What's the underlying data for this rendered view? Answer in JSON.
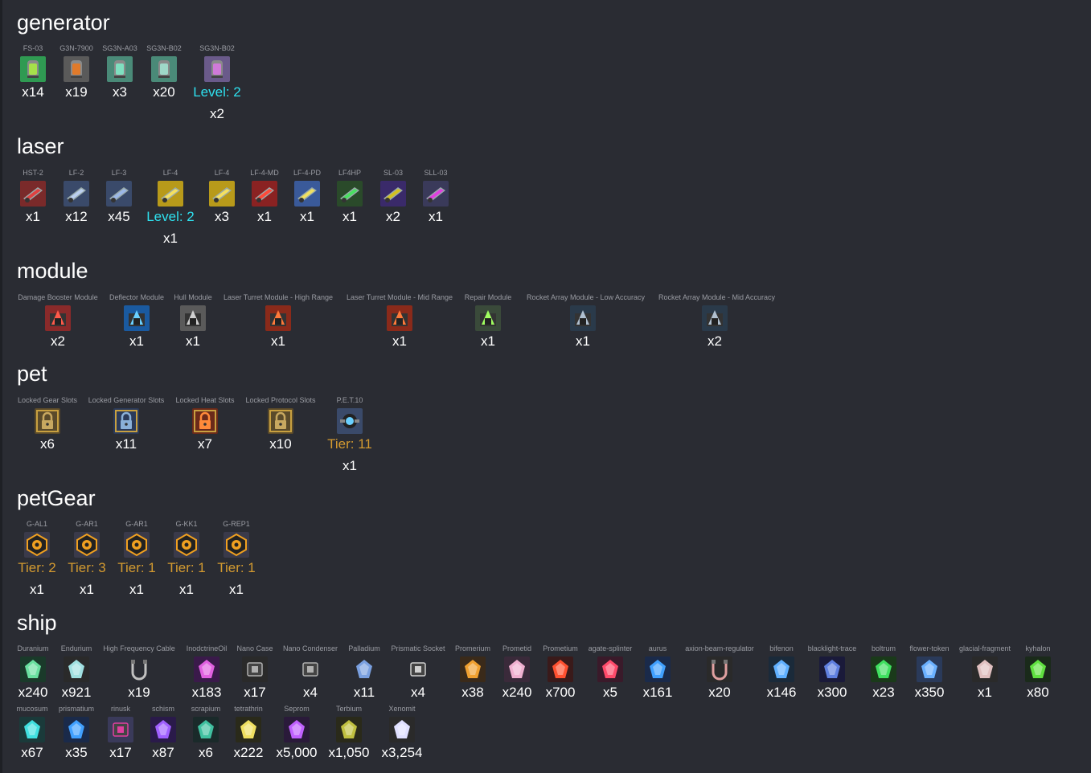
{
  "sections": [
    {
      "title": "generator",
      "items": [
        {
          "name": "FS-03",
          "count": "x14",
          "icon": "generator-icon",
          "color": "#2f9a52",
          "accent": "#a6e04a"
        },
        {
          "name": "G3N-7900",
          "count": "x19",
          "icon": "generator-icon",
          "color": "#5a5a5a",
          "accent": "#e07a2a"
        },
        {
          "name": "SG3N-A03",
          "count": "x3",
          "icon": "generator-icon",
          "color": "#4a8a78",
          "accent": "#7fe0c0"
        },
        {
          "name": "SG3N-B02",
          "count": "x20",
          "icon": "generator-icon",
          "color": "#4a8a78",
          "accent": "#9fd8c8"
        },
        {
          "name": "SG3N-B02",
          "level": "Level: 2",
          "level_style": "cyan",
          "count": "x2",
          "icon": "generator-icon",
          "color": "#6a5a8a",
          "accent": "#d07ad8"
        }
      ]
    },
    {
      "title": "laser",
      "items": [
        {
          "name": "HST-2",
          "count": "x1",
          "icon": "laser-icon",
          "color": "#7a2a2a",
          "accent": "#e04040"
        },
        {
          "name": "LF-2",
          "count": "x12",
          "icon": "laser-icon",
          "color": "#3a4a6a",
          "accent": "#bcd0f0"
        },
        {
          "name": "LF-3",
          "count": "x45",
          "icon": "laser-icon",
          "color": "#3a4a6a",
          "accent": "#9cb8e8"
        },
        {
          "name": "LF-4",
          "level": "Level: 2",
          "level_style": "cyan",
          "count": "x1",
          "icon": "laser-icon",
          "color": "#b89a1a",
          "accent": "#f5e060"
        },
        {
          "name": "LF-4",
          "count": "x3",
          "icon": "laser-icon",
          "color": "#b89a1a",
          "accent": "#f5e060"
        },
        {
          "name": "LF-4-MD",
          "count": "x1",
          "icon": "laser-icon",
          "color": "#8a2222",
          "accent": "#ff4a3a"
        },
        {
          "name": "LF-4-PD",
          "count": "x1",
          "icon": "laser-icon",
          "color": "#3a5a9a",
          "accent": "#f0e060"
        },
        {
          "name": "LF4HP",
          "count": "x1",
          "icon": "laser-icon",
          "color": "#2a4a2a",
          "accent": "#4ae060"
        },
        {
          "name": "SL-03",
          "count": "x2",
          "icon": "laser-icon",
          "color": "#3a2a6a",
          "accent": "#d4c020"
        },
        {
          "name": "SLL-03",
          "count": "x1",
          "icon": "laser-icon",
          "color": "#3a3a5a",
          "accent": "#e040e0"
        }
      ]
    },
    {
      "title": "module",
      "items": [
        {
          "name": "Damage Booster Module",
          "count": "x2",
          "icon": "module-icon",
          "color": "#8a2a2a",
          "accent": "#ff5a4a"
        },
        {
          "name": "Deflector Module",
          "count": "x1",
          "icon": "module-icon",
          "color": "#1a5aa0",
          "accent": "#6ad0ff"
        },
        {
          "name": "Hull Module",
          "count": "x1",
          "icon": "module-icon",
          "color": "#5a5a5a",
          "accent": "#d0d0d0"
        },
        {
          "name": "Laser Turret Module - High Range",
          "count": "x1",
          "icon": "module-icon",
          "color": "#8a2a1a",
          "accent": "#ff7a3a"
        },
        {
          "name": "Laser Turret Module - Mid Range",
          "count": "x1",
          "icon": "module-icon",
          "color": "#8a2a1a",
          "accent": "#ff7a3a"
        },
        {
          "name": "Repair Module",
          "count": "x1",
          "icon": "module-icon",
          "color": "#3a4a3a",
          "accent": "#a0ff60"
        },
        {
          "name": "Rocket Array Module - Low Accuracy",
          "count": "x1",
          "icon": "module-icon",
          "color": "#2a3a4a",
          "accent": "#b0c0d0"
        },
        {
          "name": "Rocket Array Module - Mid Accuracy",
          "count": "x2",
          "icon": "module-icon",
          "color": "#2a3a4a",
          "accent": "#b0c0d0"
        }
      ]
    },
    {
      "title": "pet",
      "items": [
        {
          "name": "Locked Gear Slots",
          "count": "x6",
          "icon": "lock-icon",
          "color": "#5a4a2a",
          "accent": "#c8a860"
        },
        {
          "name": "Locked Generator Slots",
          "count": "x11",
          "icon": "lock-icon",
          "color": "#2a3a5a",
          "accent": "#8ab0d8"
        },
        {
          "name": "Locked Heat Slots",
          "count": "x7",
          "icon": "lock-icon",
          "color": "#6a2a1a",
          "accent": "#ff8a3a"
        },
        {
          "name": "Locked Protocol Slots",
          "count": "x10",
          "icon": "lock-icon",
          "color": "#5a4a2a",
          "accent": "#c8a860"
        },
        {
          "name": "P.E.T.10",
          "level": "Tier: 11",
          "level_style": "gold",
          "count": "x1",
          "icon": "pet-icon",
          "color": "#3a4a6a",
          "accent": "#6ad0ff"
        }
      ]
    },
    {
      "title": "petGear",
      "items": [
        {
          "name": "G-AL1",
          "level": "Tier: 2",
          "level_style": "gold",
          "count": "x1",
          "icon": "gear-icon",
          "color": "#3a3a4a",
          "accent": "#f0a020"
        },
        {
          "name": "G-AR1",
          "level": "Tier: 3",
          "level_style": "gold",
          "count": "x1",
          "icon": "gear-icon",
          "color": "#3a3a4a",
          "accent": "#f0a020"
        },
        {
          "name": "G-AR1",
          "level": "Tier: 1",
          "level_style": "gold",
          "count": "x1",
          "icon": "gear-icon",
          "color": "#3a3a4a",
          "accent": "#f0a020"
        },
        {
          "name": "G-KK1",
          "level": "Tier: 1",
          "level_style": "gold",
          "count": "x1",
          "icon": "gear-icon",
          "color": "#3a3a4a",
          "accent": "#f0a020"
        },
        {
          "name": "G-REP1",
          "level": "Tier: 1",
          "level_style": "gold",
          "count": "x1",
          "icon": "gear-icon",
          "color": "#3a3a4a",
          "accent": "#f0a020"
        }
      ]
    },
    {
      "title": "ship",
      "items": [
        {
          "name": "Duranium",
          "count": "x240",
          "icon": "ore-icon",
          "color": "#1a3a2a",
          "accent": "#6ae0a0"
        },
        {
          "name": "Endurium",
          "count": "x921",
          "icon": "ore-icon",
          "color": "#2a2a2a",
          "accent": "#a0e0e0"
        },
        {
          "name": "High Frequency Cable",
          "count": "x19",
          "icon": "cable-icon",
          "color": "#2a2c33",
          "accent": "#c0c0c0"
        },
        {
          "name": "InodctrineOil",
          "count": "x183",
          "icon": "ore-icon",
          "color": "#3a1a4a",
          "accent": "#e060e0"
        },
        {
          "name": "Nano Case",
          "count": "x17",
          "icon": "case-icon",
          "color": "#2a2a2a",
          "accent": "#b0b0b0"
        },
        {
          "name": "Nano Condenser",
          "count": "x4",
          "icon": "case-icon",
          "color": "#2a2c33",
          "accent": "#b0b0b0"
        },
        {
          "name": "Palladium",
          "count": "x11",
          "icon": "ore-icon",
          "color": "#2a2c33",
          "accent": "#7aa0e0"
        },
        {
          "name": "Prismatic Socket",
          "count": "x4",
          "icon": "case-icon",
          "color": "#2a2c33",
          "accent": "#d0d0d0"
        },
        {
          "name": "Promerium",
          "count": "x38",
          "icon": "ore-icon",
          "color": "#3a2a1a",
          "accent": "#f0a030"
        },
        {
          "name": "Prometid",
          "count": "x240",
          "icon": "ore-icon",
          "color": "#3a2a3a",
          "accent": "#f0b0d0"
        },
        {
          "name": "Prometium",
          "count": "x700",
          "icon": "ore-icon",
          "color": "#3a1a1a",
          "accent": "#ff5030"
        },
        {
          "name": "agate-splinter",
          "count": "x5",
          "icon": "ore-icon",
          "color": "#3a1a2a",
          "accent": "#ff4a6a"
        },
        {
          "name": "aurus",
          "count": "x161",
          "icon": "ore-icon",
          "color": "#1a2a4a",
          "accent": "#40a0ff"
        },
        {
          "name": "axion-beam-regulator",
          "count": "x20",
          "icon": "cable-icon",
          "color": "#2a2a2a",
          "accent": "#e0a0a0"
        },
        {
          "name": "bifenon",
          "count": "x146",
          "icon": "ore-icon",
          "color": "#1a2a3a",
          "accent": "#60b0ff"
        },
        {
          "name": "blacklight-trace",
          "count": "x300",
          "icon": "ore-icon",
          "color": "#1a1a3a",
          "accent": "#6080e0"
        },
        {
          "name": "boltrum",
          "count": "x23",
          "icon": "ore-icon",
          "color": "#1a3a1a",
          "accent": "#40e060"
        },
        {
          "name": "flower-token",
          "count": "x350",
          "icon": "ore-icon",
          "color": "#2a3a5a",
          "accent": "#6ab0ff"
        },
        {
          "name": "glacial-fragment",
          "count": "x1",
          "icon": "ore-icon",
          "color": "#2a2a2a",
          "accent": "#e0c0c0"
        },
        {
          "name": "kyhalon",
          "count": "x80",
          "icon": "ore-icon",
          "color": "#1a2a1a",
          "accent": "#60e040"
        },
        {
          "name": "mucosum",
          "count": "x67",
          "icon": "ore-icon",
          "color": "#1a3a3a",
          "accent": "#40e0e0"
        },
        {
          "name": "prismatium",
          "count": "x35",
          "icon": "ore-icon",
          "color": "#1a2a4a",
          "accent": "#40a0ff"
        },
        {
          "name": "rinusk",
          "count": "x17",
          "icon": "case-icon",
          "color": "#3a3a5a",
          "accent": "#e040a0"
        },
        {
          "name": "schism",
          "count": "x87",
          "icon": "ore-icon",
          "color": "#2a1a4a",
          "accent": "#a060ff"
        },
        {
          "name": "scrapium",
          "count": "x6",
          "icon": "ore-icon",
          "color": "#1a2a2a",
          "accent": "#40c0a0"
        },
        {
          "name": "tetrathrin",
          "count": "x222",
          "icon": "ore-icon",
          "color": "#2a2a1a",
          "accent": "#f0e060"
        },
        {
          "name": "Seprom",
          "count": "x5,000",
          "icon": "ore-icon",
          "color": "#2a1a3a",
          "accent": "#c060ff"
        },
        {
          "name": "Terbium",
          "count": "x1,050",
          "icon": "ore-icon",
          "color": "#2a2a1a",
          "accent": "#c0c040"
        },
        {
          "name": "Xenomit",
          "count": "x3,254",
          "icon": "ore-icon",
          "color": "#2a2a2a",
          "accent": "#e0e0ff"
        }
      ]
    }
  ]
}
